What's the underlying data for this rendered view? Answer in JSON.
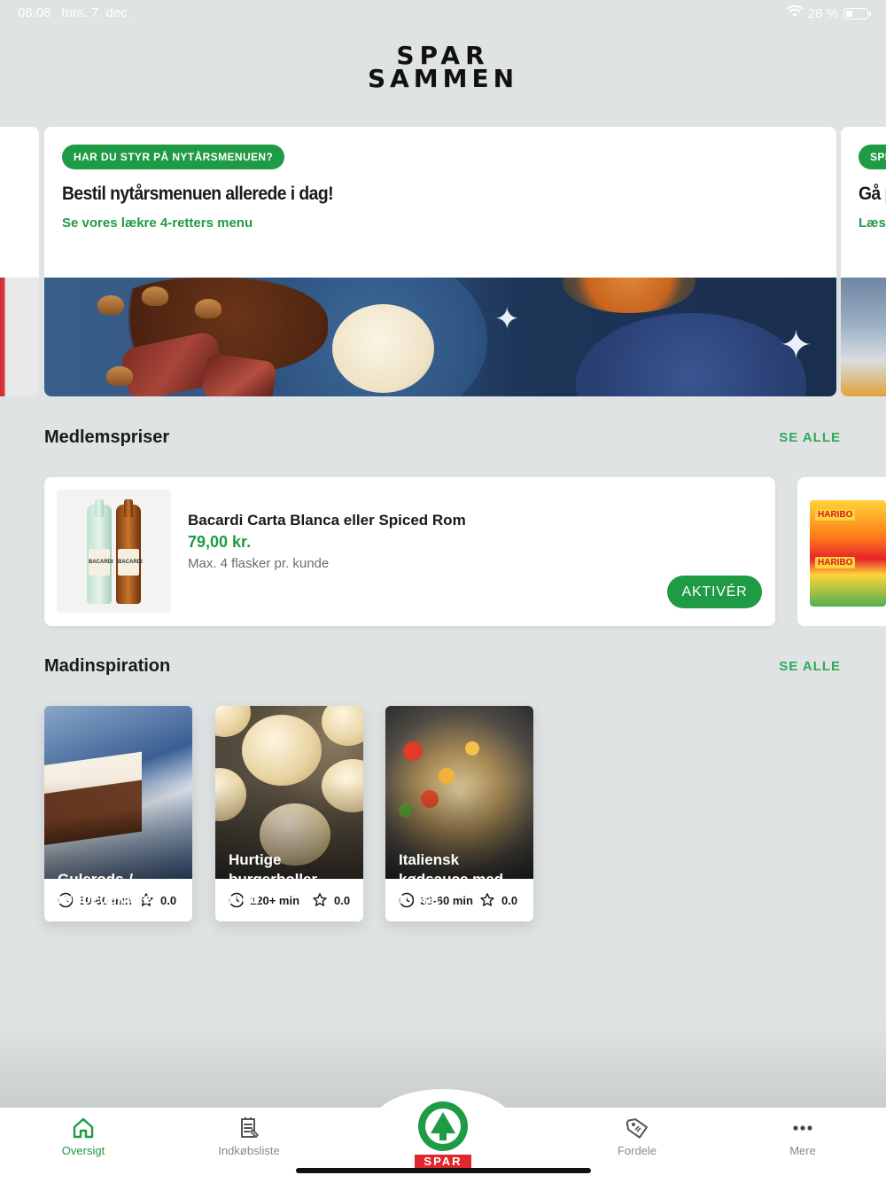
{
  "status": {
    "time": "08.08",
    "date": "tors. 7. dec.",
    "battery": "28 %",
    "battery_level": 0.28
  },
  "logo": {
    "line1": "SPAR",
    "line2": "SAMMEN"
  },
  "hero": {
    "main": {
      "pill": "HAR DU STYR PÅ NYTÅRSMENUEN?",
      "title": "Bestil nytårsmenuen allerede i dag!",
      "link": "Se vores lækre 4-retters menu"
    },
    "peek": {
      "pill": "SPI",
      "title": "Gå p",
      "link": "Læs"
    }
  },
  "member_prices": {
    "title": "Medlemspriser",
    "see_all": "SE ALLE",
    "offer": {
      "name": "Bacardi Carta Blanca eller Spiced Rom",
      "price": "79,00 kr.",
      "note": "Max. 4 flasker pr. kunde",
      "button": "AKTIVÉR",
      "bottle_label": "BACARDI"
    },
    "peek_label": "HARIBO"
  },
  "inspiration": {
    "title": "Madinspiration",
    "see_all": "SE ALLE",
    "recipes": [
      {
        "title": "Gulerods-/\nrødbedekage",
        "time": "30-60 min",
        "rating": "0.0"
      },
      {
        "title": "Hurtige\nburgerboller\nmed",
        "time": "120+ min",
        "rating": "0.0"
      },
      {
        "title": "Italiensk\nkødsauce med\ntomat",
        "time": "30-60 min",
        "rating": "0.0"
      }
    ]
  },
  "tabbar": {
    "tabs": [
      {
        "label": "Oversigt",
        "icon": "home-icon",
        "active": true
      },
      {
        "label": "Indkøbsliste",
        "icon": "shopping-list-icon",
        "active": false
      },
      {
        "label": "Fordele",
        "icon": "tag-icon",
        "active": false
      },
      {
        "label": "Mere",
        "icon": "more-icon",
        "active": false
      }
    ],
    "center_label": "SPAR"
  },
  "colors": {
    "brand_green": "#1f9a45",
    "brand_red": "#e1262d",
    "background": "#dfe3e3"
  }
}
